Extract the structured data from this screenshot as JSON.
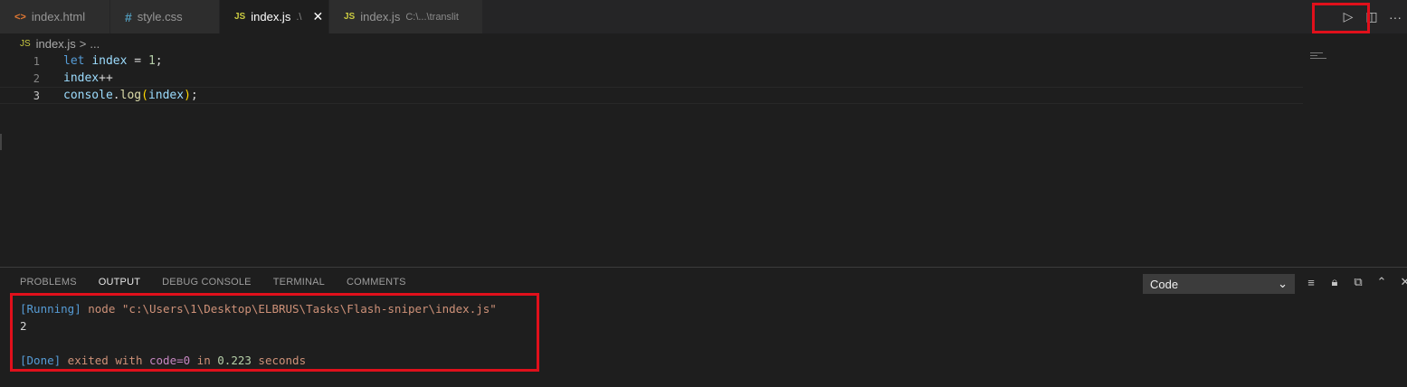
{
  "tabs": [
    {
      "icon": "html-file-icon",
      "glyph": "<>",
      "label": "index.html",
      "desc": "",
      "active": false
    },
    {
      "icon": "css-file-icon",
      "glyph": "#",
      "label": "style.css",
      "desc": "",
      "active": false
    },
    {
      "icon": "js-file-icon",
      "glyph": "JS",
      "label": "index.js",
      "desc": ".\\",
      "active": true
    },
    {
      "icon": "js-file-icon",
      "glyph": "JS",
      "label": "index.js",
      "desc": "C:\\...\\translit",
      "active": false
    }
  ],
  "tab_actions": {
    "run_glyph": "▷",
    "split_glyph": "◫",
    "more_glyph": "···"
  },
  "breadcrumb": {
    "glyph": "JS",
    "file": "index.js",
    "separator": ">",
    "rest": "..."
  },
  "editor": {
    "lines": [
      {
        "num": "1",
        "tokens": [
          {
            "t": "let",
            "c": "kw"
          },
          {
            "t": " ",
            "c": ""
          },
          {
            "t": "index",
            "c": "var"
          },
          {
            "t": " = ",
            "c": ""
          },
          {
            "t": "1",
            "c": "num"
          },
          {
            "t": ";",
            "c": ""
          }
        ]
      },
      {
        "num": "2",
        "tokens": [
          {
            "t": "index",
            "c": "var"
          },
          {
            "t": "++",
            "c": ""
          }
        ]
      },
      {
        "num": "3",
        "tokens": [
          {
            "t": "console",
            "c": "var"
          },
          {
            "t": ".",
            "c": ""
          },
          {
            "t": "log",
            "c": "fn"
          },
          {
            "t": "(",
            "c": "paren"
          },
          {
            "t": "index",
            "c": "var"
          },
          {
            "t": ")",
            "c": "paren"
          },
          {
            "t": ";",
            "c": ""
          }
        ]
      }
    ],
    "current_line": 3
  },
  "panel": {
    "tabs": [
      "PROBLEMS",
      "OUTPUT",
      "DEBUG CONSOLE",
      "TERMINAL",
      "COMMENTS"
    ],
    "active_tab": "OUTPUT",
    "output_channel": "Code",
    "output": {
      "running_tag": "[Running]",
      "running_cmd": " node \"c:\\Users\\1\\Desktop\\ELBRUS\\Tasks\\Flash-sniper\\index.js\"",
      "result": "2",
      "done_tag": "[Done]",
      "done_text_1": " exited with ",
      "done_code": "code=0",
      "done_text_2": " in ",
      "done_time": "0.223",
      "done_text_3": " seconds"
    }
  }
}
